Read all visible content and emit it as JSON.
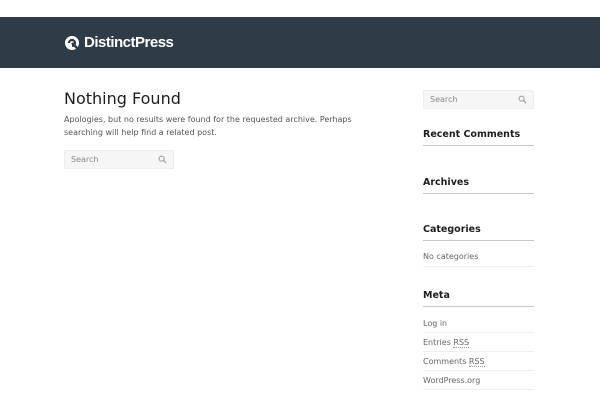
{
  "site": {
    "name": "DistinctPress"
  },
  "main": {
    "title": "Nothing Found",
    "message": "Apologies, but no results were found for the requested archive. Perhaps searching will help find a related post.",
    "search_placeholder": "Search"
  },
  "sidebar": {
    "search_placeholder": "Search",
    "recent_comments_title": "Recent Comments",
    "archives_title": "Archives",
    "categories_title": "Categories",
    "no_categories": "No categories",
    "meta_title": "Meta",
    "meta_links": {
      "login": "Log in",
      "entries_prefix": "Entries ",
      "entries_abbr": "RSS",
      "comments_prefix": "Comments ",
      "comments_abbr": "RSS",
      "wordpress": "WordPress.org"
    }
  },
  "icons": {
    "logo": "logo-icon",
    "search": "search-icon"
  },
  "colors": {
    "header_bg": "#2f3b47",
    "header_text": "#ffffff"
  }
}
